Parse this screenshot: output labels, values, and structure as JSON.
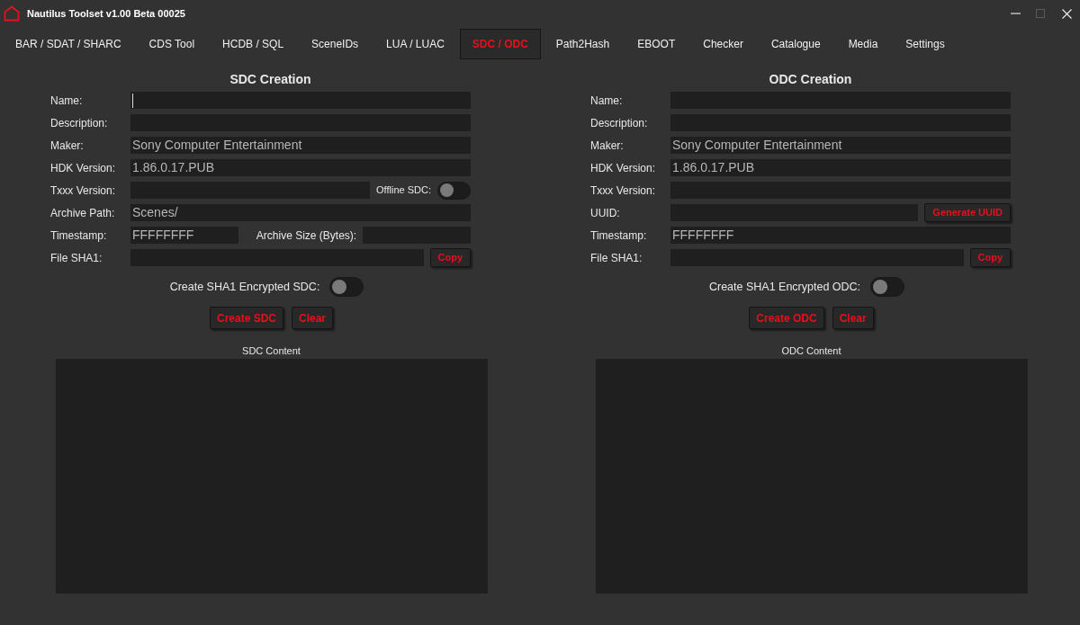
{
  "window": {
    "title": "Nautilus Toolset v1.00 Beta 00025"
  },
  "tabs": [
    {
      "label": "BAR / SDAT / SHARC",
      "selected": false
    },
    {
      "label": "CDS Tool",
      "selected": false
    },
    {
      "label": "HCDB / SQL",
      "selected": false
    },
    {
      "label": "SceneIDs",
      "selected": false
    },
    {
      "label": "LUA / LUAC",
      "selected": false
    },
    {
      "label": "SDC / ODC",
      "selected": true
    },
    {
      "label": "Path2Hash",
      "selected": false
    },
    {
      "label": "EBOOT",
      "selected": false
    },
    {
      "label": "Checker",
      "selected": false
    },
    {
      "label": "Catalogue",
      "selected": false
    },
    {
      "label": "Media",
      "selected": false
    },
    {
      "label": "Settings",
      "selected": false
    }
  ],
  "panels": [
    {
      "title": "SDC Creation",
      "rows": [
        {
          "label": "Name:",
          "items": [
            {
              "kind": "field",
              "focused": true
            }
          ]
        },
        {
          "label": "Description:",
          "items": [
            {
              "kind": "field",
              "focused": false
            }
          ]
        },
        {
          "label": "Maker:",
          "items": [
            {
              "kind": "field",
              "value": "Sony Computer Entertainment",
              "focused": false
            }
          ]
        },
        {
          "label": "HDK Version:",
          "items": [
            {
              "kind": "field",
              "value": "1.86.0.17.PUB",
              "focused": false
            }
          ]
        },
        {
          "label": "Txxx Version:",
          "items": [
            {
              "kind": "field",
              "focused": false
            },
            {
              "kind": "toggle",
              "label": "Offline SDC:",
              "on": false
            }
          ]
        },
        {
          "label": "Archive Path:",
          "items": [
            {
              "kind": "field",
              "value": "Scenes/",
              "focused": false
            }
          ]
        },
        {
          "label": "Timestamp:",
          "items": [
            {
              "kind": "field",
              "value": "FFFFFFFF",
              "focused": false
            },
            {
              "kind": "field",
              "label": "Archive Size (Bytes):",
              "focused": false
            }
          ]
        },
        {
          "label": "File SHA1:",
          "items": [
            {
              "kind": "field",
              "focused": false
            },
            {
              "kind": "button",
              "label": "Copy"
            }
          ]
        }
      ],
      "switch": {
        "label": "Create SHA1 Encrypted SDC:",
        "on": false
      },
      "buttons": [
        "Create SDC",
        "Clear"
      ],
      "content": {
        "label": "SDC Content"
      }
    },
    {
      "title": "ODC Creation",
      "rows": [
        {
          "label": "Name:",
          "items": [
            {
              "kind": "field",
              "focused": false
            }
          ]
        },
        {
          "label": "Description:",
          "items": [
            {
              "kind": "field",
              "focused": false
            }
          ]
        },
        {
          "label": "Maker:",
          "items": [
            {
              "kind": "field",
              "value": "Sony Computer Entertainment",
              "focused": false
            }
          ]
        },
        {
          "label": "HDK Version:",
          "items": [
            {
              "kind": "field",
              "value": "1.86.0.17.PUB",
              "focused": false
            }
          ]
        },
        {
          "label": "Txxx Version:",
          "items": [
            {
              "kind": "field",
              "focused": false
            }
          ]
        },
        {
          "label": "UUID:",
          "items": [
            {
              "kind": "field",
              "focused": false
            },
            {
              "kind": "button",
              "label": "Generate UUID"
            }
          ]
        },
        {
          "label": "Timestamp:",
          "items": [
            {
              "kind": "field",
              "value": "FFFFFFFF",
              "focused": false
            }
          ]
        },
        {
          "label": "File SHA1:",
          "items": [
            {
              "kind": "field",
              "focused": false
            },
            {
              "kind": "button",
              "label": "Copy"
            }
          ]
        }
      ],
      "switch": {
        "label": "Create SHA1 Encrypted ODC:",
        "on": false
      },
      "buttons": [
        "Create ODC",
        "Clear"
      ],
      "content": {
        "label": "ODC Content"
      }
    }
  ]
}
